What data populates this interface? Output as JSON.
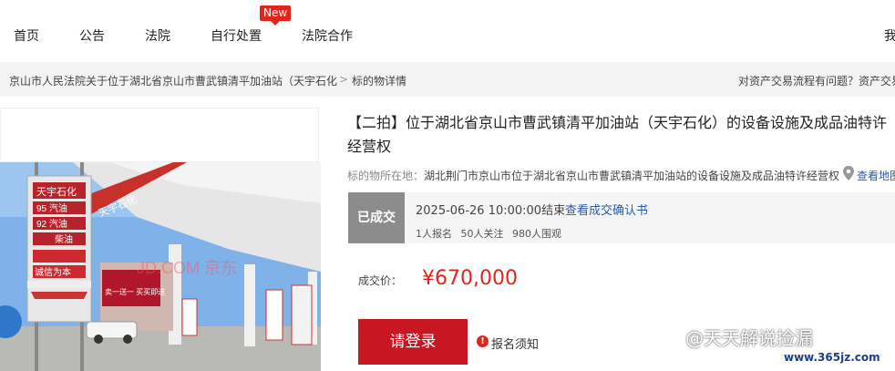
{
  "nav": {
    "items": [
      "首页",
      "公告",
      "法院",
      "自行处置",
      "法院合作"
    ],
    "new_badge": "New",
    "right_cut": "我"
  },
  "breadcrumb": {
    "court": "京山市人民法院关于位于湖北省京山市曹武镇清平加油站（天宇石化",
    "sep": ">",
    "current": "标的物详情",
    "right": "对资产交易流程有问题？资产交易"
  },
  "item": {
    "title": "【二拍】位于湖北省京山市曹武镇清平加油站（天宇石化）的设备设施及成品油特许经营权",
    "location_label": "标的物所在地：",
    "location": "湖北荆门市京山市位于湖北省京山市曹武镇清平加油站的设备设施及成品油特许经营权",
    "map_link": "查看地图",
    "status": "已成交",
    "end_time": "2025-06-26 10:00:00结束",
    "confirm_link": "查看成交确认书",
    "stats": [
      "1人报名",
      "50人关注",
      "980人围观"
    ],
    "price_label": "成交价：",
    "price": "¥670,000",
    "login_button": "请登录",
    "notice_link": "报名须知"
  },
  "photo": {
    "sign_brand": "天宇石化",
    "sign_rows": [
      "95 汽油",
      "92 汽油",
      "柴油"
    ],
    "sign_motto": "诚信为本",
    "canopy_text": "天宇石化",
    "banner_text": "卖一送一 买买即送",
    "photo_watermark": "JD.COM 京东"
  },
  "watermark": {
    "text": "@天天解说捡漏",
    "site": "www.365jz.com"
  },
  "colors": {
    "accent": "#e1251b",
    "button": "#c81623",
    "link": "#2a5caa",
    "status_tag": "#8c8c8c"
  }
}
